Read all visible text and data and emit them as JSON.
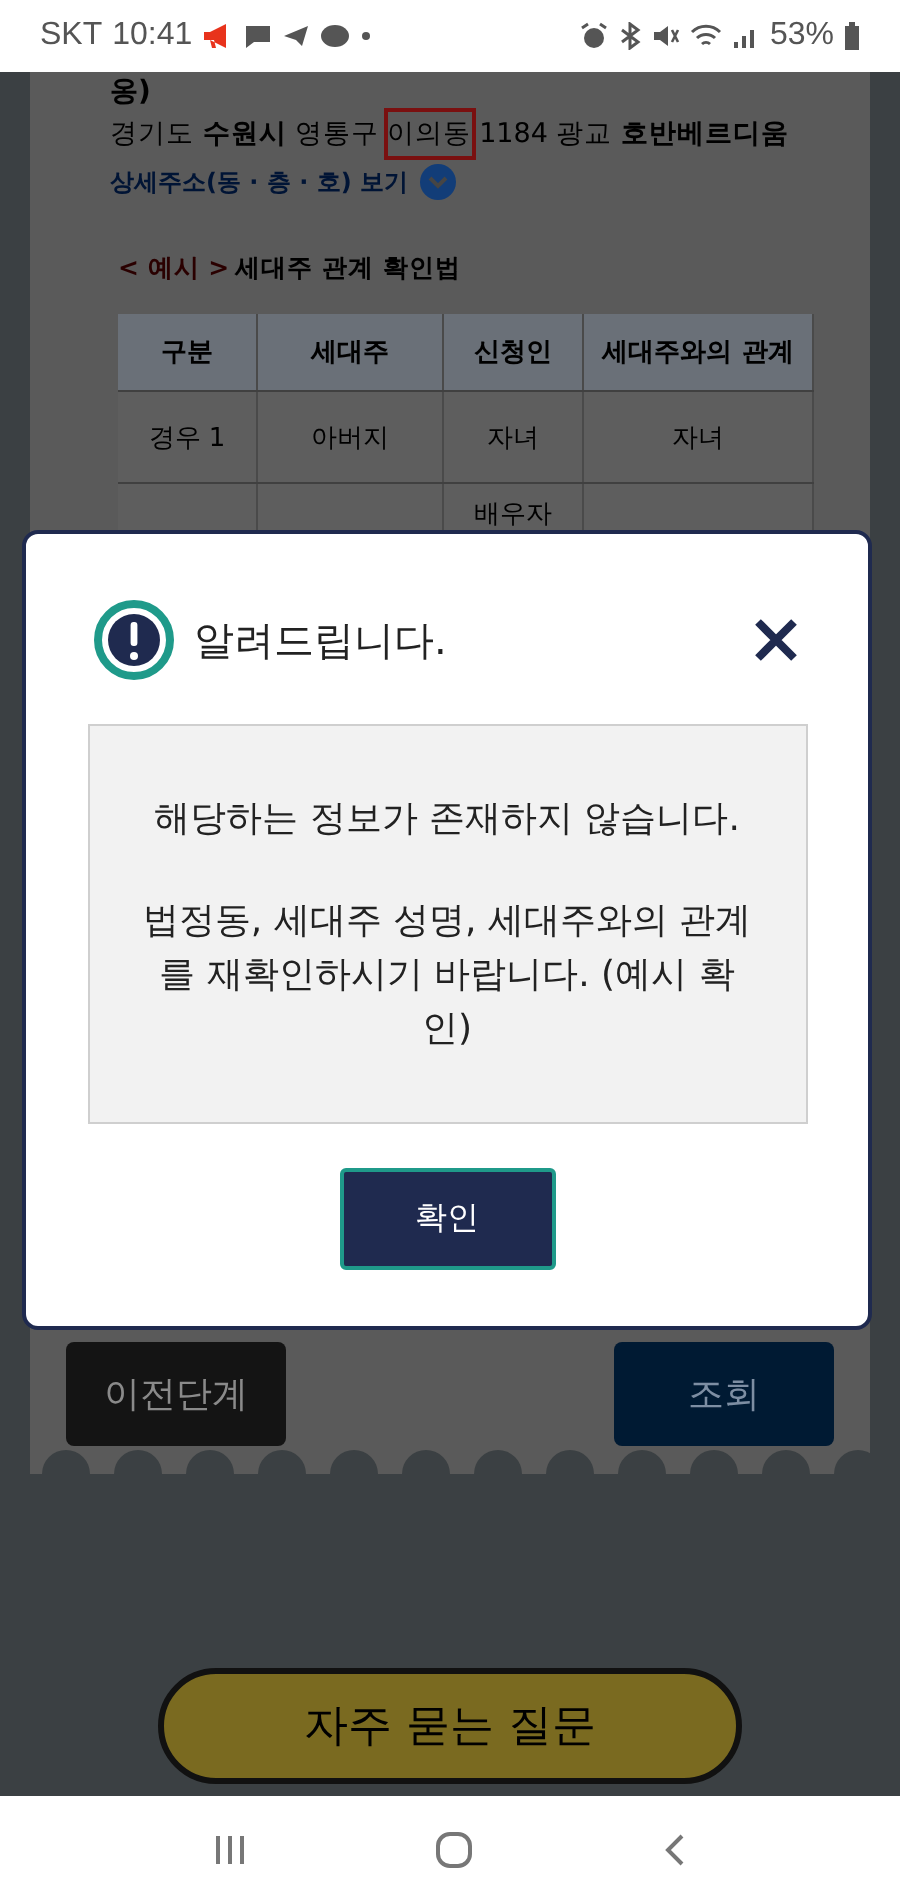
{
  "status_bar": {
    "carrier": "SKT",
    "time": "10:41",
    "battery": "53%"
  },
  "background": {
    "address_tail": "옹)",
    "address": [
      {
        "text": "경기도 **수원시** 영통구",
        "highlighted": false
      },
      {
        "text": "이의동",
        "highlighted": true
      },
      {
        "text": "1184 광교 **호반베르디움**",
        "highlighted": false
      }
    ],
    "detail_link": "상세주소(동 · 층 · 호) 보기",
    "example_tag": "< 예시 >",
    "example_title": "세대주 관계 확인법",
    "table": {
      "columns": [
        "구분",
        "세대주",
        "신청인",
        "세대주와의 관계"
      ],
      "rows": [
        [
          "경우 1",
          "아버지",
          "자녀",
          "자녀"
        ]
      ],
      "partial_row_applicant": "배우자"
    },
    "buttons": [
      {
        "label": "이전단계",
        "kind": "secondary"
      },
      {
        "label": "조회",
        "kind": "primary"
      }
    ],
    "faq_button": "자주 묻는 질문"
  },
  "dialog": {
    "title": "알려드립니다.",
    "message": [
      "해당하는 정보가 존재하지 않습니다.",
      "법정동, 세대주 성명, 세대주와의 관계를 재확인하시기 바랍니다. (예시 확인)"
    ],
    "confirm": "확인"
  }
}
